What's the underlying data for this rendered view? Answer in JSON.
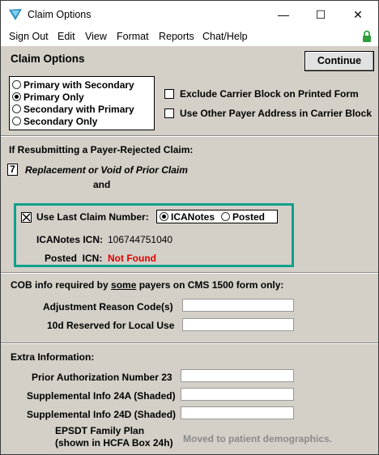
{
  "window": {
    "title": "Claim Options",
    "minimize": "—",
    "maximize": "☐",
    "close": "✕"
  },
  "menu": [
    "Sign Out",
    "Edit",
    "View",
    "Format",
    "Reports",
    "Chat/Help"
  ],
  "header": {
    "title": "Claim Options",
    "continue_label": "Continue"
  },
  "claim_type": {
    "options": [
      "Primary with Secondary",
      "Primary Only",
      "Secondary with Primary",
      "Secondary Only"
    ],
    "selected": "Primary Only"
  },
  "checkboxes": {
    "exclude_carrier": "Exclude Carrier Block on Printed Form",
    "other_payer": "Use Other Payer Address in Carrier Block"
  },
  "resubmit": {
    "heading": "If Resubmitting a Payer-Rejected Claim:",
    "code": "7",
    "code_label": "Replacement or Void of Prior Claim",
    "and": "and"
  },
  "last_claim": {
    "checkbox_label": "Use Last Claim Number:",
    "checked": true,
    "options": [
      "ICANotes",
      "Posted"
    ],
    "selected": "ICANotes",
    "icanotes_icn_label": "ICANotes ICN:",
    "icanotes_icn_value": "106744751040",
    "posted_icn_label": "Posted  ICN:",
    "posted_icn_value": "Not Found"
  },
  "cob": {
    "heading_pre": "COB info required by ",
    "heading_some": "some",
    "heading_post": " payers on CMS 1500 form only:",
    "adjustment_label": "Adjustment Reason Code(s)",
    "reserved_label": "10d Reserved for Local Use"
  },
  "extra": {
    "heading": "Extra Information:",
    "prior_auth_label": "Prior Authorization Number 23",
    "supp_24a_label": "Supplemental Info 24A (Shaded)",
    "supp_24d_label": "Supplemental Info 24D (Shaded)",
    "epsdt_label_1": "EPSDT Family Plan",
    "epsdt_label_2": "(shown in HCFA Box 24h)",
    "epsdt_note": "Moved to patient demographics."
  },
  "colors": {
    "accent_teal": "#10a08a",
    "not_found_red": "#e00000",
    "lock_green": "#2e9e3e"
  }
}
